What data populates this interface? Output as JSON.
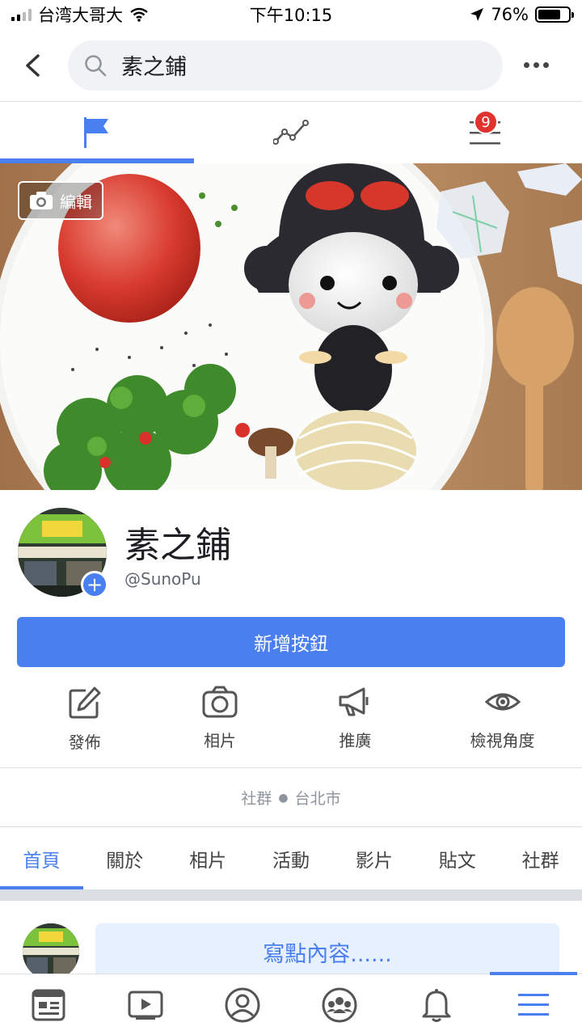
{
  "status_bar": {
    "carrier": "台湾大哥大",
    "time": "下午10:15",
    "battery": "76%",
    "battery_level": 0.76
  },
  "search": {
    "value": "素之鋪",
    "icons": [
      "back-arrow-icon",
      "search-icon",
      "more-icon"
    ]
  },
  "top_tabs": [
    {
      "icon": "flag-icon",
      "active": true
    },
    {
      "icon": "insights-icon",
      "active": false
    },
    {
      "icon": "menu-icon",
      "active": false,
      "badge": "9"
    }
  ],
  "cover": {
    "edit_label": "編輯"
  },
  "profile": {
    "name": "素之鋪",
    "handle": "@SunoPu"
  },
  "primary_button": "新增按鈕",
  "actions": [
    {
      "label": "發佈",
      "icon": "edit-icon"
    },
    {
      "label": "相片",
      "icon": "camera-icon"
    },
    {
      "label": "推廣",
      "icon": "megaphone-icon"
    },
    {
      "label": "檢視角度",
      "icon": "eye-icon"
    }
  ],
  "category": {
    "type": "社群",
    "location": "台北市"
  },
  "section_tabs": [
    "首頁",
    "關於",
    "相片",
    "活動",
    "影片",
    "貼文",
    "社群"
  ],
  "composer": {
    "placeholder": "寫點內容......"
  },
  "bottom_nav": [
    {
      "icon": "news-feed-icon",
      "active": false
    },
    {
      "icon": "watch-icon",
      "active": false
    },
    {
      "icon": "profile-icon",
      "active": false
    },
    {
      "icon": "groups-icon",
      "active": false
    },
    {
      "icon": "bell-icon",
      "active": false
    },
    {
      "icon": "hamburger-icon",
      "active": true
    }
  ],
  "colors": {
    "accent": "#4a7ff0",
    "badge": "#e0332e",
    "composer_bg": "#e7f0fe"
  }
}
